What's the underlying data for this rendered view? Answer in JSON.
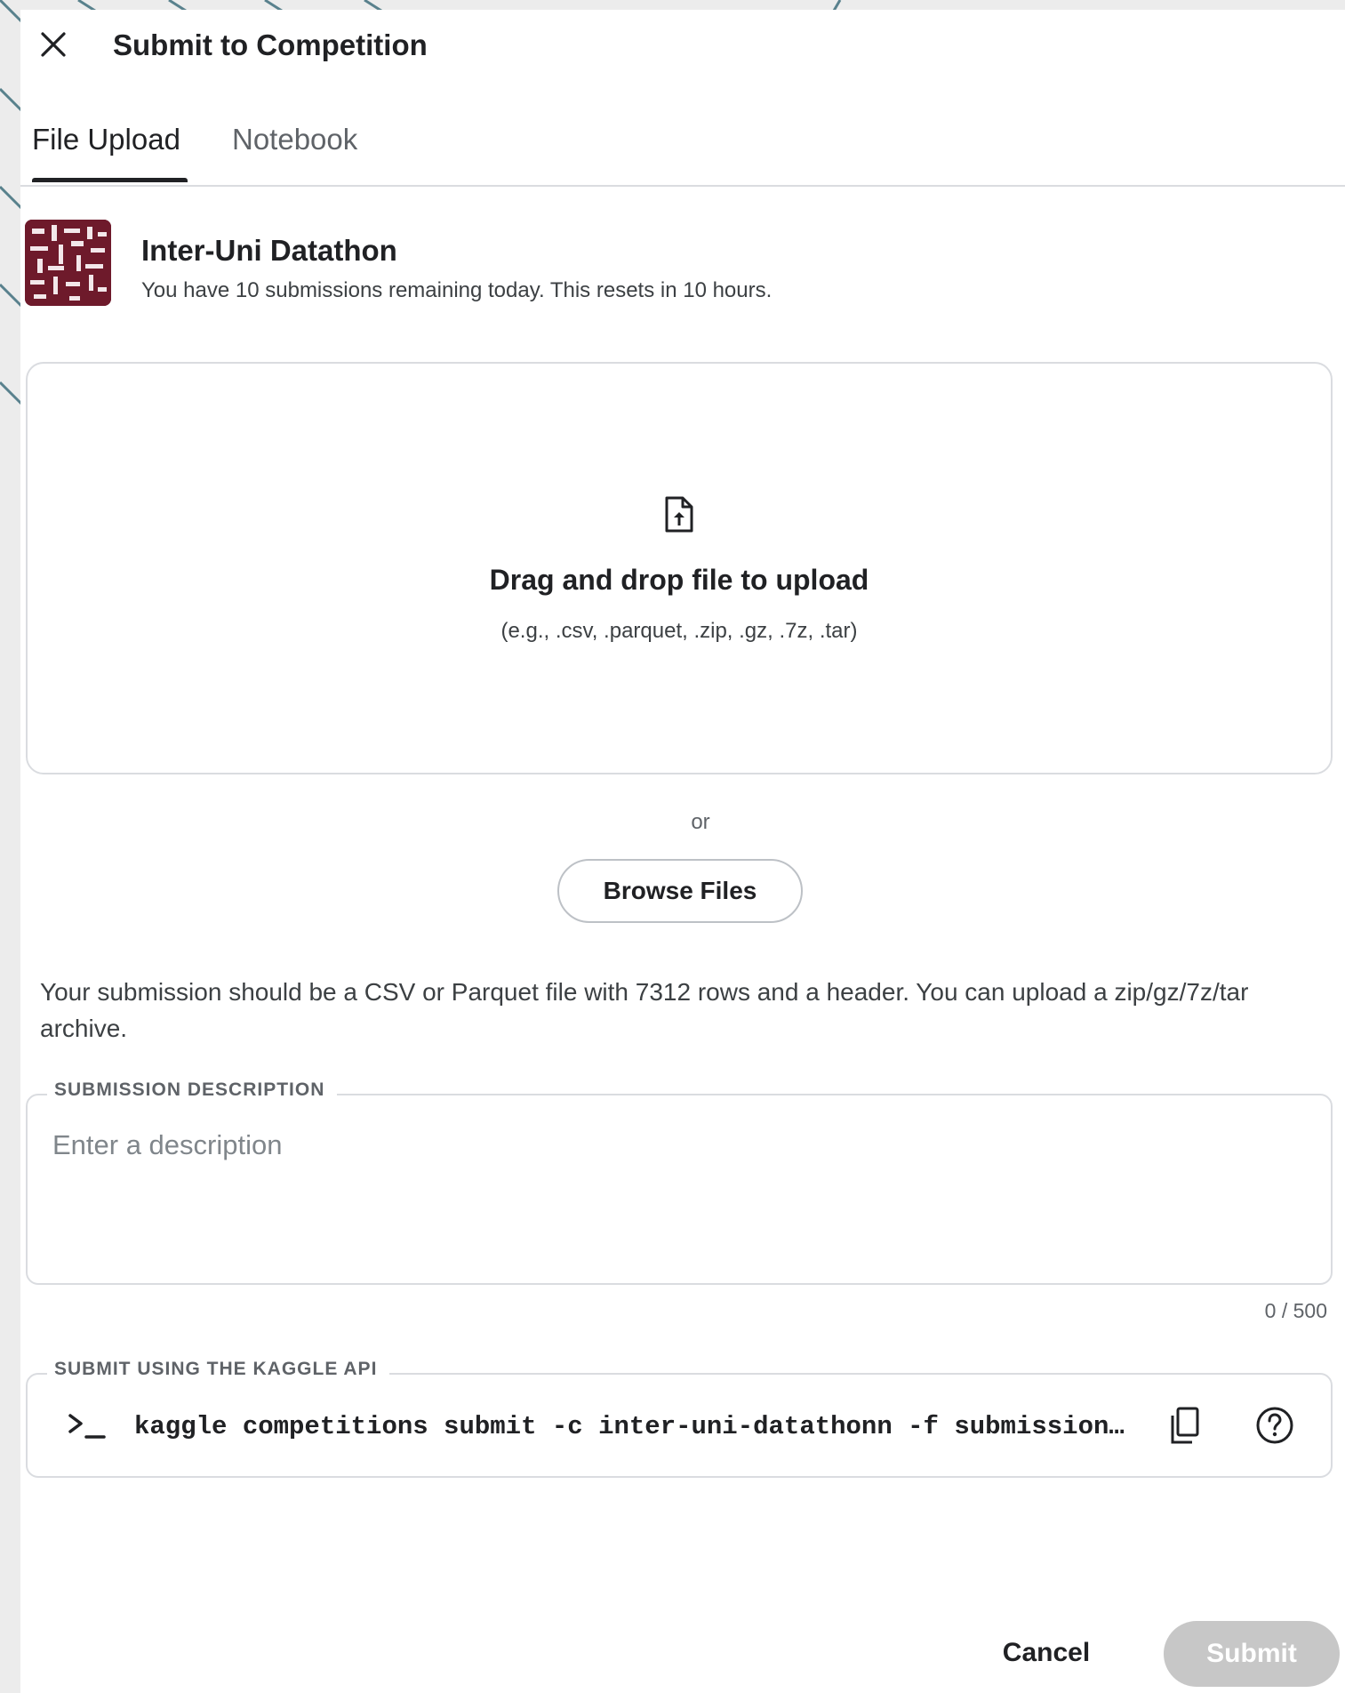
{
  "dialog": {
    "title": "Submit to Competition",
    "close_icon": "close-icon"
  },
  "tabs": [
    {
      "label": "File Upload",
      "active": true
    },
    {
      "label": "Notebook",
      "active": false
    }
  ],
  "competition": {
    "name": "Inter-Uni Datathon",
    "info": "You have 10 submissions remaining today. This resets in 10 hours."
  },
  "upload": {
    "icon": "file-upload-icon",
    "title": "Drag and drop file to upload",
    "hint": "(e.g., .csv, .parquet, .zip, .gz, .7z, .tar)",
    "or": "or",
    "browse_label": "Browse Files",
    "requirements": "Your submission should be a CSV or Parquet file with 7312 rows and a header. You can upload a zip/gz/7z/tar archive."
  },
  "description": {
    "label": "SUBMISSION DESCRIPTION",
    "placeholder": "Enter a description",
    "value": "",
    "count": "0 / 500"
  },
  "api": {
    "label": "SUBMIT USING THE KAGGLE API",
    "command": "kaggle competitions submit -c inter-uni-datathonn -f submission.csv -m \"Message\"",
    "icons": [
      "terminal-icon",
      "copy-icon",
      "help-icon"
    ]
  },
  "footer": {
    "cancel_label": "Cancel",
    "submit_label": "Submit",
    "submit_enabled": false
  },
  "colors": {
    "text": "#202124",
    "border": "#dadce0",
    "logo": "#6e1a2b",
    "submit_disabled": "#c7c7c7"
  }
}
